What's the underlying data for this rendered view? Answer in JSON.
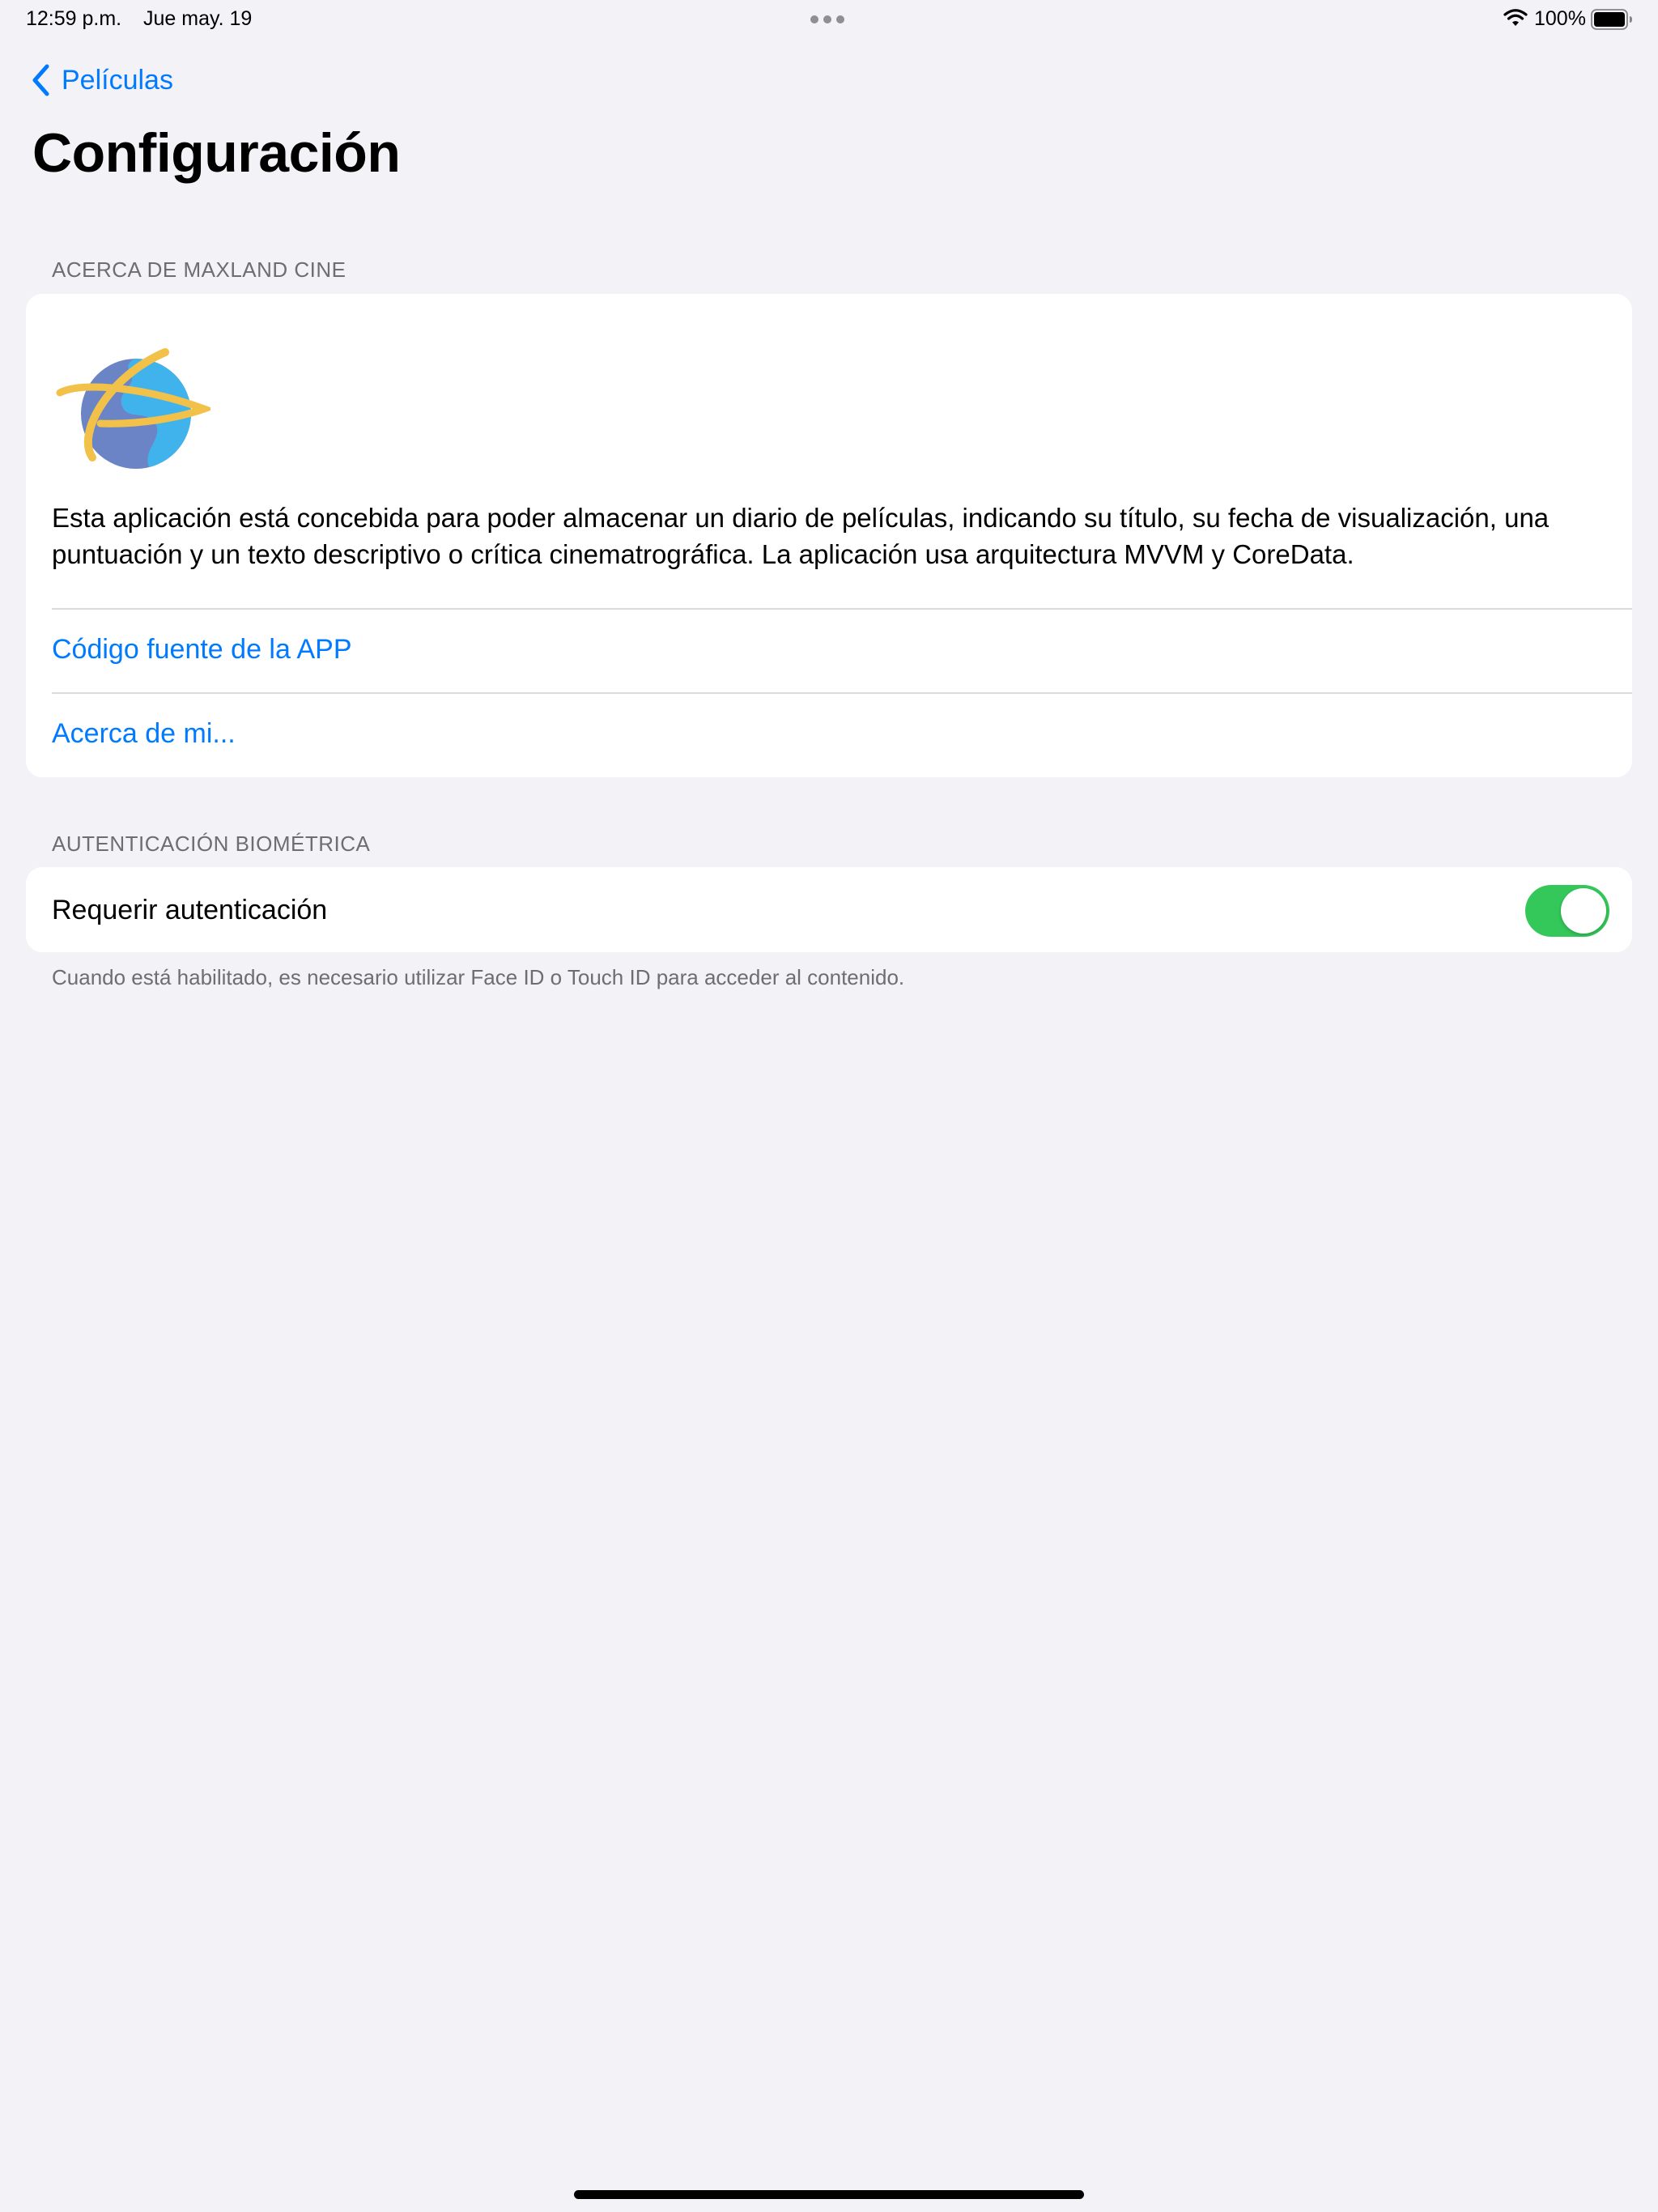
{
  "status_bar": {
    "time": "12:59 p.m.",
    "date": "Jue may. 19",
    "battery_percent": "100%",
    "battery_level": 1.0
  },
  "nav": {
    "back_label": "Películas",
    "title": "Configuración"
  },
  "about_section": {
    "header": "ACERCA DE MAXLAND CINE",
    "description": "Esta aplicación está concebida para poder almacenar un diario de películas, indicando su título, su fecha de visualización, una puntuación y un texto descriptivo o crítica cinematrográfica. La aplicación usa arquitectura MVVM y CoreData.",
    "links": [
      {
        "label": "Código fuente de la APP"
      },
      {
        "label": "Acerca de mi..."
      }
    ]
  },
  "biometric_section": {
    "header": "AUTENTICACIÓN BIOMÉTRICA",
    "toggle_label": "Requerir autenticación",
    "toggle_on": true,
    "footer": "Cuando está habilitado, es necesario utilizar Face ID o Touch ID para acceder al contenido."
  },
  "colors": {
    "accent": "#007aff",
    "toggle_on": "#34c759",
    "background": "#f2f2f7",
    "secondary_text": "#6d6d72"
  }
}
